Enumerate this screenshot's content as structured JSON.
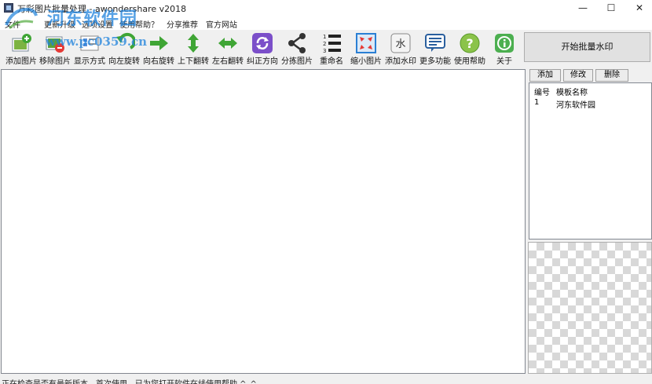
{
  "window": {
    "title": "万彩图片批量处理 - awondershare v2018",
    "minimize": "—",
    "maximize": "☐",
    "close": "✕"
  },
  "watermark": {
    "main": "河东软件园",
    "url": "www.pc0359.cn"
  },
  "menu": {
    "items": [
      "文件",
      "更新升级",
      "选项设置",
      "使用帮助？",
      "分享推荐",
      "官方网站"
    ]
  },
  "toolbar": {
    "tools": [
      {
        "label": "添加图片",
        "icon": "add-image-icon"
      },
      {
        "label": "移除图片",
        "icon": "remove-image-icon"
      },
      {
        "label": "显示方式",
        "icon": "display-mode-icon"
      },
      {
        "label": "向左旋转",
        "icon": "rotate-left-icon"
      },
      {
        "label": "向右旋转",
        "icon": "rotate-right-icon"
      },
      {
        "label": "上下翻转",
        "icon": "flip-vertical-icon"
      },
      {
        "label": "左右翻转",
        "icon": "flip-horizontal-icon"
      },
      {
        "label": "纠正方向",
        "icon": "correct-orientation-icon"
      },
      {
        "label": "分拣图片",
        "icon": "sort-images-icon"
      },
      {
        "label": "重命名",
        "icon": "rename-icon"
      },
      {
        "label": "缩小图片",
        "icon": "shrink-image-icon"
      },
      {
        "label": "添加水印",
        "icon": "add-watermark-icon"
      },
      {
        "label": "更多功能",
        "icon": "more-features-icon"
      },
      {
        "label": "使用帮助",
        "icon": "help-icon"
      },
      {
        "label": "关于",
        "icon": "about-icon"
      }
    ],
    "start_label": "开始批量水印"
  },
  "right_panel": {
    "tabs": [
      "添加",
      "修改",
      "删除"
    ],
    "columns": [
      "编号",
      "模板名称"
    ],
    "rows": [
      {
        "id": "1",
        "name": "河东软件园"
      }
    ]
  },
  "status": {
    "left": "正在检查是否有最新版本",
    "right": "首次使用，已为您打开软件在线使用帮助 ^_^"
  },
  "colors": {
    "accent_green": "#3fa535",
    "accent_purple": "#7b4fc9",
    "accent_blue": "#2a7fd4"
  }
}
